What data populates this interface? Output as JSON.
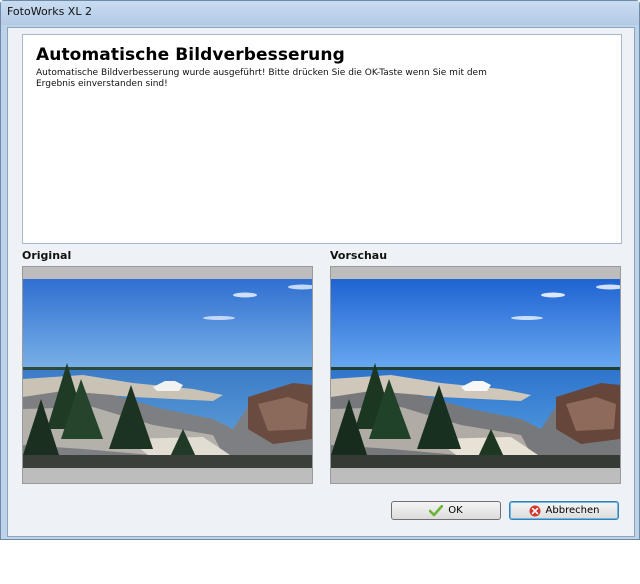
{
  "window": {
    "title": "FotoWorks XL 2"
  },
  "header": {
    "title": "Automatische Bildverbesserung",
    "description": "Automatische Bildverbesserung wurde ausgeführt! Bitte drücken Sie die OK-Taste wenn Sie mit dem Ergebnis einverstanden sind!"
  },
  "panels": {
    "original_label": "Original",
    "preview_label": "Vorschau"
  },
  "buttons": {
    "ok_label": "OK",
    "cancel_label": "Abbrechen"
  },
  "icons": {
    "ok": "check-icon",
    "cancel": "cancel-icon"
  },
  "colors": {
    "accent_check": "#6bb536",
    "cancel_red": "#d23a2f"
  }
}
